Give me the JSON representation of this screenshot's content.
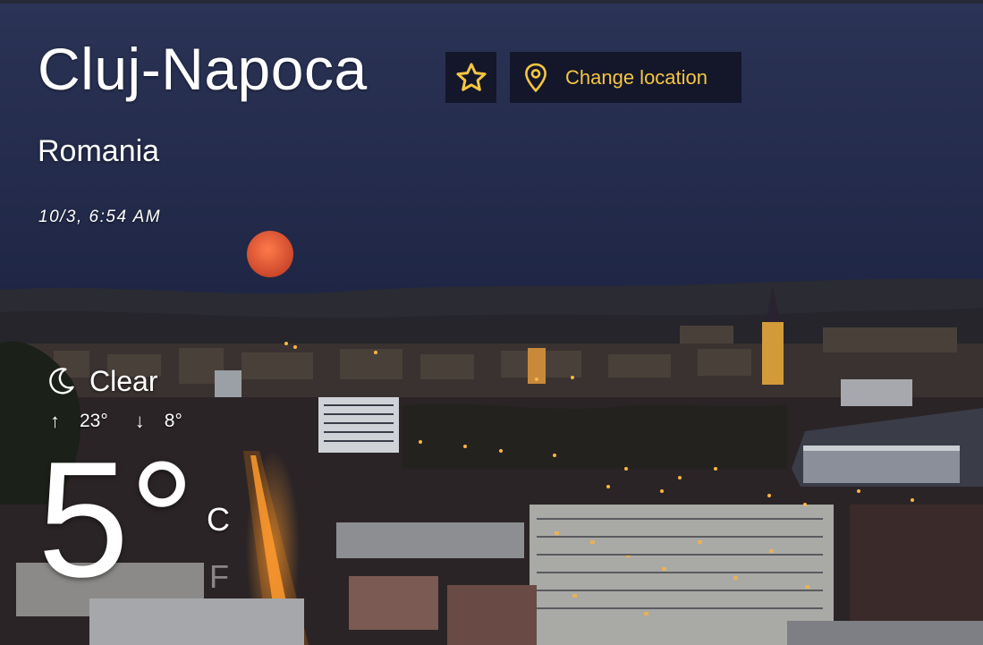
{
  "location": {
    "city": "Cluj-Napoca",
    "country": "Romania",
    "datetime": "10/3, 6:54 AM",
    "change_location_label": "Change location"
  },
  "weather": {
    "condition": "Clear",
    "high": "23°",
    "low": "8°",
    "temperature": "5°",
    "unit_active": "C",
    "unit_inactive": "F"
  },
  "icons": {
    "favorite": "star-icon",
    "location": "map-pin-icon",
    "condition": "moon-icon",
    "high": "arrow-up-icon",
    "low": "arrow-down-icon"
  },
  "colors": {
    "accent": "#f5c542",
    "button_bg": "#14172a",
    "sky": "#232a4a",
    "city_lights": "#ff9a2e"
  }
}
